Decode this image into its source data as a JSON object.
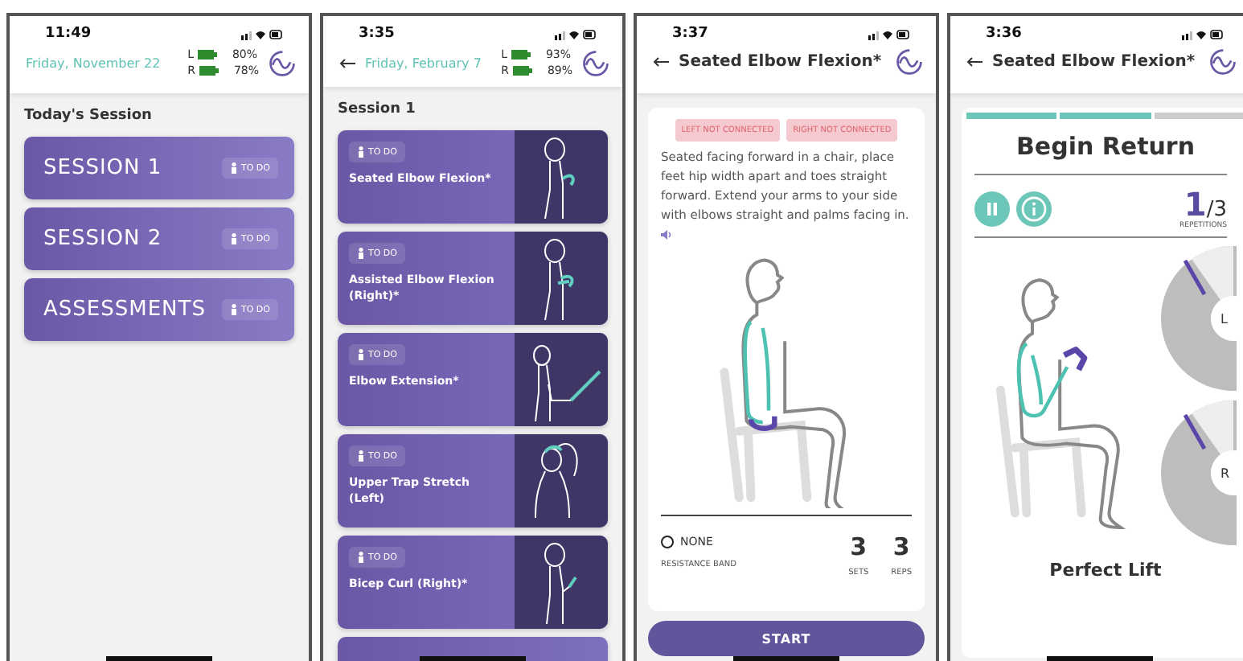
{
  "screens": [
    {
      "kind": "home",
      "time": "11:49",
      "back": false,
      "date": "Friday, November 22",
      "batteries": [
        {
          "side": "L",
          "reading": "80%"
        },
        {
          "side": "R",
          "reading": "78%"
        }
      ],
      "section_title": "Today's Session",
      "sessions": [
        {
          "title": "SESSION 1",
          "badge": "TO DO"
        },
        {
          "title": "SESSION 2",
          "badge": "TO DO"
        },
        {
          "title": "ASSESSMENTS",
          "badge": "TO DO"
        }
      ]
    },
    {
      "kind": "session",
      "time": "3:35",
      "back": true,
      "date": "Friday, February 7",
      "batteries": [
        {
          "side": "L",
          "reading": "93%"
        },
        {
          "side": "R",
          "reading": "89%"
        }
      ],
      "section_title": "Session 1",
      "exercises": [
        {
          "kind": "flexion",
          "name": "Seated Elbow Flexion*",
          "badge": "TO DO"
        },
        {
          "kind": "assisted",
          "name": "Assisted Elbow Flexion (Right)*",
          "badge": "TO DO"
        },
        {
          "kind": "extension",
          "name": "Elbow Extension*",
          "badge": "TO DO"
        },
        {
          "kind": "trap",
          "name": "Upper Trap Stretch (Left)",
          "badge": "TO DO"
        },
        {
          "kind": "curl",
          "name": "Bicep Curl (Right)*",
          "badge": "TO DO"
        }
      ],
      "cut_off_card": true
    },
    {
      "kind": "exercise",
      "time": "3:37",
      "back": true,
      "title": "Seated Elbow Flexion*",
      "tags": [
        "LEFT NOT CONNECTED",
        "RIGHT NOT CONNECTED"
      ],
      "description": "Seated facing forward in a chair, place feet hip width apart and toes straight forward. Extend your arms to your side with elbows straight and palms facing in.",
      "band": {
        "label": "NONE",
        "caption": "RESISTANCE BAND",
        "selected": false
      },
      "stats": [
        {
          "value": "3",
          "label": "SETS"
        },
        {
          "value": "3",
          "label": "REPS"
        }
      ],
      "button": "START"
    },
    {
      "kind": "workout",
      "time": "3:36",
      "back": true,
      "title": "Seated Elbow Flexion*",
      "progress": [
        {
          "done": true
        },
        {
          "done": true
        },
        {
          "done": false
        }
      ],
      "prompt": "Begin Return",
      "count": "1",
      "total": "/3",
      "count_label": "REPETITIONS",
      "gauges": [
        {
          "side": "L"
        },
        {
          "side": "R"
        }
      ],
      "feedback": "Perfect Lift"
    }
  ]
}
